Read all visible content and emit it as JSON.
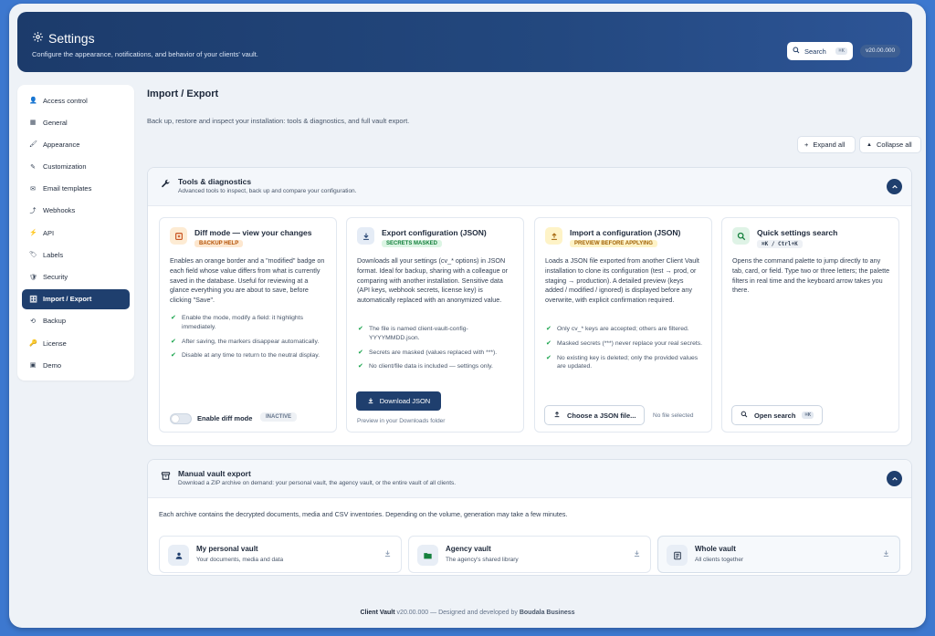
{
  "header": {
    "title": "Settings",
    "subtitle": "Configure the appearance, notifications, and behavior of your clients' vault.",
    "search_label": "Search",
    "search_shortcut": "⌘K",
    "version": "v20.00.000"
  },
  "sidebar": {
    "items": [
      {
        "label": "Access control",
        "icon": "person-icon",
        "glyph": "👤"
      },
      {
        "label": "General",
        "icon": "grid-icon",
        "glyph": "▦"
      },
      {
        "label": "Appearance",
        "icon": "brush-icon",
        "glyph": "🖌"
      },
      {
        "label": "Customization",
        "icon": "sliders-icon",
        "glyph": "✎"
      },
      {
        "label": "Email templates",
        "icon": "envelope-icon",
        "glyph": "✉"
      },
      {
        "label": "Webhooks",
        "icon": "webhook-icon",
        "glyph": "⤴"
      },
      {
        "label": "API",
        "icon": "code-icon",
        "glyph": "⚡"
      },
      {
        "label": "Labels",
        "icon": "tag-icon",
        "glyph": "🏷"
      },
      {
        "label": "Security",
        "icon": "shield-icon",
        "glyph": "🛡"
      },
      {
        "label": "Import / Export",
        "icon": "database-icon",
        "glyph": "🗄",
        "active": true
      },
      {
        "label": "Backup",
        "icon": "history-icon",
        "glyph": "⟲"
      },
      {
        "label": "License",
        "icon": "key-icon",
        "glyph": "🔑"
      },
      {
        "label": "Demo",
        "icon": "demo-icon",
        "glyph": "▣"
      }
    ]
  },
  "main": {
    "title": "Import / Export",
    "description": "Back up, restore and inspect your installation: tools & diagnostics, and full vault export.",
    "expand_all": "Expand all",
    "collapse_all": "Collapse all"
  },
  "tools": {
    "title": "Tools & diagnostics",
    "description": "Advanced tools to inspect, back up and compare your configuration.",
    "cards": {
      "diff": {
        "title": "Diff mode — view your changes",
        "badge": "BACKUP HELP",
        "description": "Enables an orange border and a \"modified\" badge on each field whose value differs from what is currently saved in the database. Useful for reviewing at a glance everything you are about to save, before clicking \"Save\".",
        "bullets": [
          "Enable the mode, modify a field: it highlights immediately.",
          "After saving, the markers disappear automatically.",
          "Disable at any time to return to the neutral display."
        ],
        "toggle_label": "Enable diff mode",
        "status": "INACTIVE"
      },
      "export": {
        "title": "Export configuration (JSON)",
        "badge": "SECRETS MASKED",
        "description": "Downloads all your settings (cv_* options) in JSON format. Ideal for backup, sharing with a colleague or comparing with another installation. Sensitive data (API keys, webhook secrets, license key) is automatically replaced with an anonymized value.",
        "bullets": [
          "The file is named client-vault-config-YYYYMMDD.json.",
          "Secrets are masked (values replaced with ***).",
          "No client/file data is included — settings only."
        ],
        "button": "Download JSON",
        "note": "Preview in your Downloads folder"
      },
      "import": {
        "title": "Import a configuration (JSON)",
        "badge": "PREVIEW BEFORE APPLYING",
        "description": "Loads a JSON file exported from another Client Vault installation to clone its configuration (test → prod, or staging → production). A detailed preview (keys added / modified / ignored) is displayed before any overwrite, with explicit confirmation required.",
        "bullets": [
          "Only cv_* keys are accepted; others are filtered.",
          "Masked secrets (***) never replace your real secrets.",
          "No existing key is deleted; only the provided values are updated."
        ],
        "button": "Choose a JSON file...",
        "file_status": "No file selected"
      },
      "search": {
        "title": "Quick settings search",
        "badge": "⌘K / Ctrl+K",
        "description": "Opens the command palette to jump directly to any tab, card, or field. Type two or three letters; the palette filters in real time and the keyboard arrow takes you there.",
        "button": "Open search",
        "button_shortcut": "⌘K"
      }
    }
  },
  "vault": {
    "title": "Manual vault export",
    "description": "Download a ZIP archive on demand: your personal vault, the agency vault, or the entire vault of all clients.",
    "note": "Each archive contains the decrypted documents, media and CSV inventories. Depending on the volume, generation may take a few minutes.",
    "cards": [
      {
        "title": "My personal vault",
        "description": "Your documents, media and data"
      },
      {
        "title": "Agency vault",
        "description": "The agency's shared library"
      },
      {
        "title": "Whole vault",
        "description": "All clients together"
      }
    ]
  },
  "footer": {
    "product": "Client Vault",
    "version": "v20.00.000",
    "text": "— Designed and developed by",
    "brand": "Boudala Business"
  },
  "colors": {
    "primary": "#1f3f6e",
    "background": "#3d78cf",
    "success": "#16a34a"
  }
}
